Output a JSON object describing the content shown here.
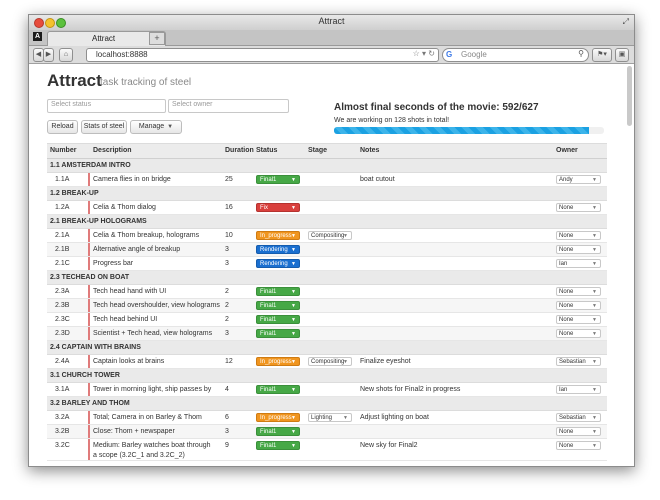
{
  "window": {
    "title": "Attract",
    "app_badge": "A"
  },
  "tab": {
    "label": "Attract",
    "new_tab": "+"
  },
  "toolbar": {
    "url": "localhost:8888",
    "search_placeholder": "Google",
    "search_engine_glyph": "G"
  },
  "header": {
    "title": "Attract",
    "subtitle": "task tracking of steel"
  },
  "filters": {
    "status_placeholder": "Select status",
    "owner_placeholder": "Select owner"
  },
  "buttons": {
    "reload": "Reload",
    "stats": "Stats of steel",
    "manage": "Manage"
  },
  "progress": {
    "title": "Almost final seconds of the movie: 592/627",
    "subtitle": "We are working on 128 shots in total!",
    "fraction": 0.944
  },
  "table": {
    "headers": {
      "number": "Number",
      "description": "Description",
      "duration": "Duration",
      "status": "Status",
      "stage": "Stage",
      "notes": "Notes",
      "owner": "Owner"
    },
    "groups": [
      {
        "title": "1.1 AMSTERDAM INTRO",
        "rows": [
          {
            "number": "1.1A",
            "description": "Camera flies in on bridge",
            "duration": "25",
            "status": "Final1",
            "status_type": "final",
            "stage": "",
            "notes": "boat cutout",
            "owner": "Andy"
          }
        ]
      },
      {
        "title": "1.2 BREAK-UP",
        "rows": [
          {
            "number": "1.2A",
            "description": "Celia & Thom dialog",
            "duration": "16",
            "status": "Fix",
            "status_type": "fix",
            "stage": "",
            "notes": "",
            "owner": "None"
          }
        ]
      },
      {
        "title": "2.1 BREAK-UP HOLOGRAMS",
        "rows": [
          {
            "number": "2.1A",
            "description": "Celia & Thom breakup, holograms",
            "duration": "10",
            "status": "In_progress",
            "status_type": "progress",
            "stage": "Compositing",
            "notes": "",
            "owner": "None"
          },
          {
            "number": "2.1B",
            "description": "Alternative angle of breakup",
            "duration": "3",
            "status": "Rendering",
            "status_type": "rendering",
            "stage": "",
            "notes": "",
            "owner": "None"
          },
          {
            "number": "2.1C",
            "description": "Progress bar",
            "duration": "3",
            "status": "Rendering",
            "status_type": "rendering",
            "stage": "",
            "notes": "",
            "owner": "Ian"
          }
        ]
      },
      {
        "title": "2.3 TECHEAD ON BOAT",
        "rows": [
          {
            "number": "2.3A",
            "description": "Tech head hand with UI",
            "duration": "2",
            "status": "Final1",
            "status_type": "final",
            "stage": "",
            "notes": "",
            "owner": "None"
          },
          {
            "number": "2.3B",
            "description": "Tech head overshoulder, view holograms",
            "duration": "2",
            "status": "Final1",
            "status_type": "final",
            "stage": "",
            "notes": "",
            "owner": "None"
          },
          {
            "number": "2.3C",
            "description": "Tech head behind UI",
            "duration": "2",
            "status": "Final1",
            "status_type": "final",
            "stage": "",
            "notes": "",
            "owner": "None"
          },
          {
            "number": "2.3D",
            "description": "Scientist + Tech head, view holograms",
            "duration": "3",
            "status": "Final1",
            "status_type": "final",
            "stage": "",
            "notes": "",
            "owner": "None"
          }
        ]
      },
      {
        "title": "2.4 CAPTAIN WITH BRAINS",
        "rows": [
          {
            "number": "2.4A",
            "description": "Captain looks at brains",
            "duration": "12",
            "status": "In_progress",
            "status_type": "progress",
            "stage": "Compositing",
            "notes": "Finalize eyeshot",
            "owner": "Sebastian"
          }
        ]
      },
      {
        "title": "3.1 CHURCH TOWER",
        "rows": [
          {
            "number": "3.1A",
            "description": "Tower in morning light, ship passes by",
            "duration": "4",
            "status": "Final1",
            "status_type": "final",
            "stage": "",
            "notes": "New shots for Final2 in progress",
            "owner": "Ian"
          }
        ]
      },
      {
        "title": "3.2 BARLEY AND THOM",
        "rows": [
          {
            "number": "3.2A",
            "description": "Total; Camera in on Barley & Thom",
            "duration": "6",
            "status": "In_progress",
            "status_type": "progress",
            "stage": "Lighting",
            "notes": "Adjust lighting on boat",
            "owner": "Sebastian"
          },
          {
            "number": "3.2B",
            "description": "Close: Thom + newspaper",
            "duration": "3",
            "status": "Final1",
            "status_type": "final",
            "stage": "",
            "notes": "",
            "owner": "None"
          },
          {
            "number": "3.2C",
            "description": "Medium: Barley watches boat through a scope (3.2C_1 and 3.2C_2)",
            "duration": "9",
            "status": "Final1",
            "status_type": "final",
            "stage": "",
            "notes": "New sky for Final2",
            "owner": "None"
          }
        ]
      }
    ]
  }
}
